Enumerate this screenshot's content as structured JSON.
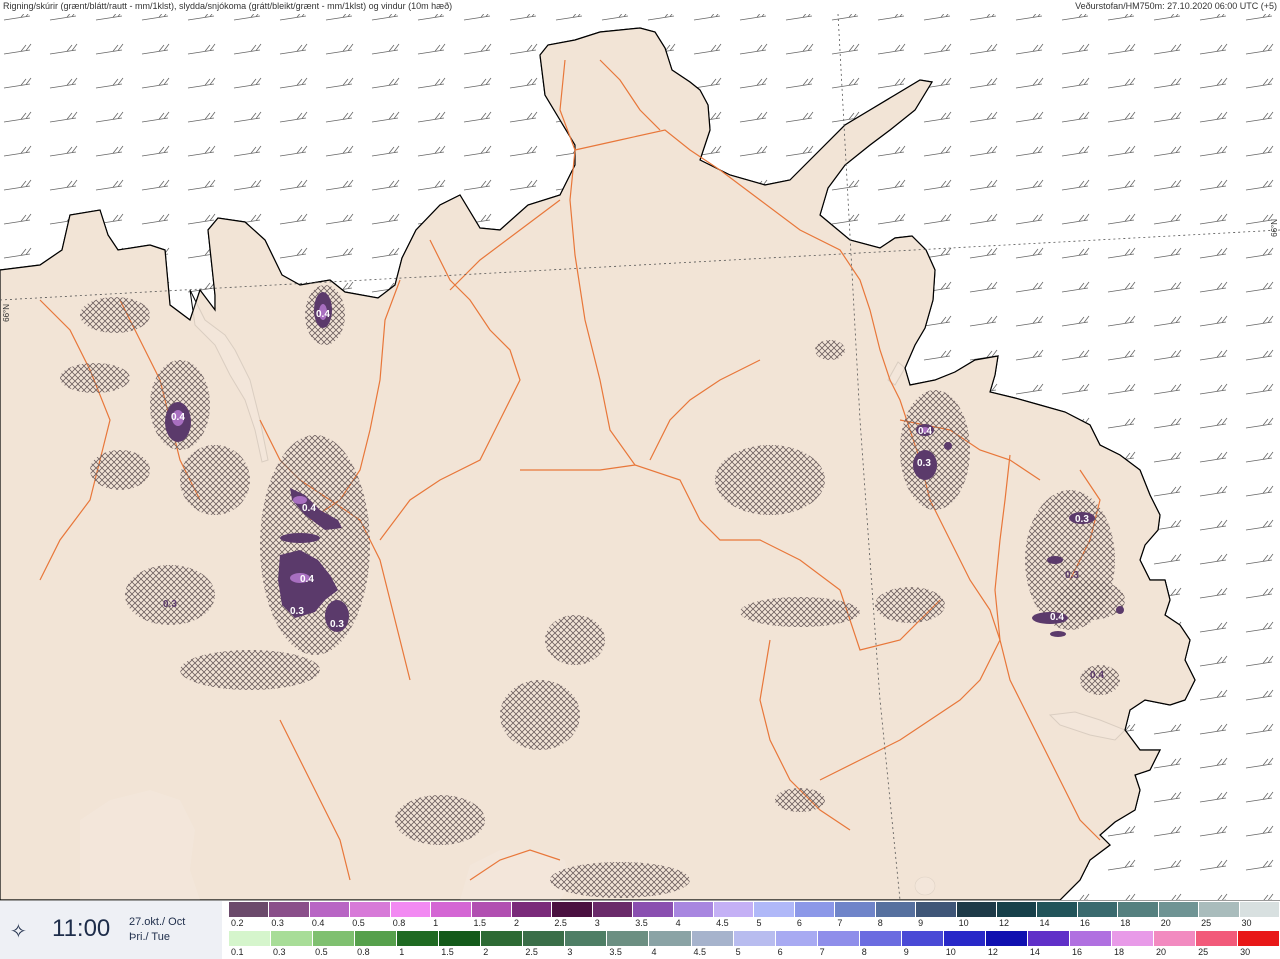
{
  "header": {
    "title": "Rigning/skúrir (grænt/blátt/rautt - mm/1klst), slydda/snjókoma (grátt/bleikt/grænt - mm/1klst) og vindur (10m hæð)",
    "source": "Veðurstofan/HM750m: 27.10.2020 06:00 UTC (+5)"
  },
  "map": {
    "lat_label_left": "66°N",
    "lat_label_right": "66°N",
    "contour_labels": [
      {
        "text": "0.4",
        "id": "a"
      },
      {
        "text": "0.4",
        "id": "b"
      },
      {
        "text": "0.4",
        "id": "c"
      },
      {
        "text": "0.4",
        "id": "d"
      },
      {
        "text": "0.3",
        "id": "e"
      },
      {
        "text": "0.3",
        "id": "f"
      },
      {
        "text": "0.3",
        "id": "g"
      },
      {
        "text": "0.4",
        "id": "h"
      },
      {
        "text": "0.3",
        "id": "i"
      },
      {
        "text": "0.3",
        "id": "j"
      },
      {
        "text": "0.3",
        "id": "k"
      },
      {
        "text": "0.4",
        "id": "l"
      },
      {
        "text": "0.4",
        "id": "m"
      }
    ],
    "colors": {
      "land": "#f2e4d6",
      "sea": "#ffffff",
      "roads": "#e8773a",
      "precip": "#5b3a6b",
      "coast": "#000000"
    }
  },
  "footer": {
    "time": "11:00",
    "date_line1": "27.okt./ Oct",
    "date_line2": "Þri./ Tue",
    "snow_scale": {
      "labels": [
        "0.2",
        "0.3",
        "0.4",
        "0.5",
        "0.8",
        "1",
        "1.5",
        "2",
        "2.5",
        "3",
        "3.5",
        "4",
        "4.5",
        "5",
        "6",
        "7",
        "8",
        "9",
        "10",
        "12",
        "14",
        "16",
        "18",
        "20",
        "25",
        "30"
      ],
      "colors": [
        "#6b4a6b",
        "#8a4f8a",
        "#b865c4",
        "#d77ad8",
        "#f28af2",
        "#d466d4",
        "#b14fb1",
        "#7a2a7a",
        "#4a1040",
        "#6a2a6a",
        "#8a4fb0",
        "#a886e0",
        "#c4b0f5",
        "#b0b8f8",
        "#8c98e8",
        "#6f84c9",
        "#56709f",
        "#3f5678",
        "#1e3a48",
        "#17404a",
        "#22545a",
        "#3a6a6e",
        "#55807f",
        "#6f9494",
        "#a9bcbc",
        "#d8e0e0"
      ]
    },
    "rain_scale": {
      "labels": [
        "0.1",
        "0.3",
        "0.5",
        "0.8",
        "1",
        "1.5",
        "2",
        "2.5",
        "3",
        "3.5",
        "4",
        "4.5",
        "5",
        "6",
        "7",
        "8",
        "9",
        "10",
        "12",
        "14",
        "16",
        "18",
        "20",
        "25",
        "30"
      ],
      "colors": [
        "#d5f5cc",
        "#a8dd98",
        "#7fc070",
        "#56a04c",
        "#1f6a22",
        "#145a1a",
        "#2d6a34",
        "#3a6e48",
        "#4e7e65",
        "#6c8f82",
        "#8aa3a5",
        "#a6b3cc",
        "#b8bcef",
        "#a8aaf2",
        "#8f8eea",
        "#6b6ce0",
        "#4a4ad6",
        "#2828c8",
        "#1010b0",
        "#6030c8",
        "#b070e0",
        "#e89ae8",
        "#f28ac0",
        "#f25a7a",
        "#e81818"
      ]
    }
  }
}
